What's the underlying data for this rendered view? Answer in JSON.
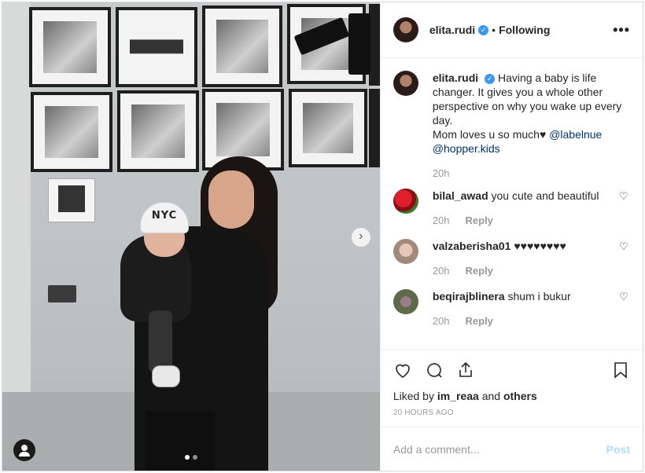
{
  "post": {
    "photo": {
      "cap_text": "NYC",
      "dots": 2,
      "active_dot": 0
    },
    "header": {
      "username": "elita.rudi",
      "separator": "•",
      "follow_status": "Following",
      "more": "•••"
    },
    "caption": {
      "username": "elita.rudi",
      "text": "Having a baby is life changer. It gives you a whole other perspective on why you wake up every day.",
      "line2": "Mom loves u so much♥",
      "mention1": "@labelnue",
      "mention2": "@hopper.kids",
      "time": "20h"
    },
    "comments": [
      {
        "username": "bilal_awad",
        "text": "you cute and beautiful",
        "time": "20h",
        "reply": "Reply"
      },
      {
        "username": "valzaberisha01",
        "text": "♥♥♥♥♥♥♥♥",
        "time": "20h",
        "reply": "Reply"
      },
      {
        "username": "beqirajblinera",
        "text": "shum i bukur",
        "time": "20h",
        "reply": "Reply"
      }
    ],
    "likes": {
      "prefix": "Liked by",
      "user": "im_reaa",
      "joiner": "and",
      "others": "others"
    },
    "timestamp": "20 HOURS AGO",
    "add_comment": {
      "placeholder": "Add a comment...",
      "post_label": "Post"
    },
    "icons": [
      "heart-icon",
      "comment-icon",
      "share-icon",
      "bookmark-icon",
      "user-tag-icon",
      "chevron-right-icon",
      "verified-icon"
    ],
    "colors": {
      "link": "#003569",
      "verified": "#3897f0",
      "muted": "#999999",
      "post_disabled": "#b3dbff"
    }
  }
}
